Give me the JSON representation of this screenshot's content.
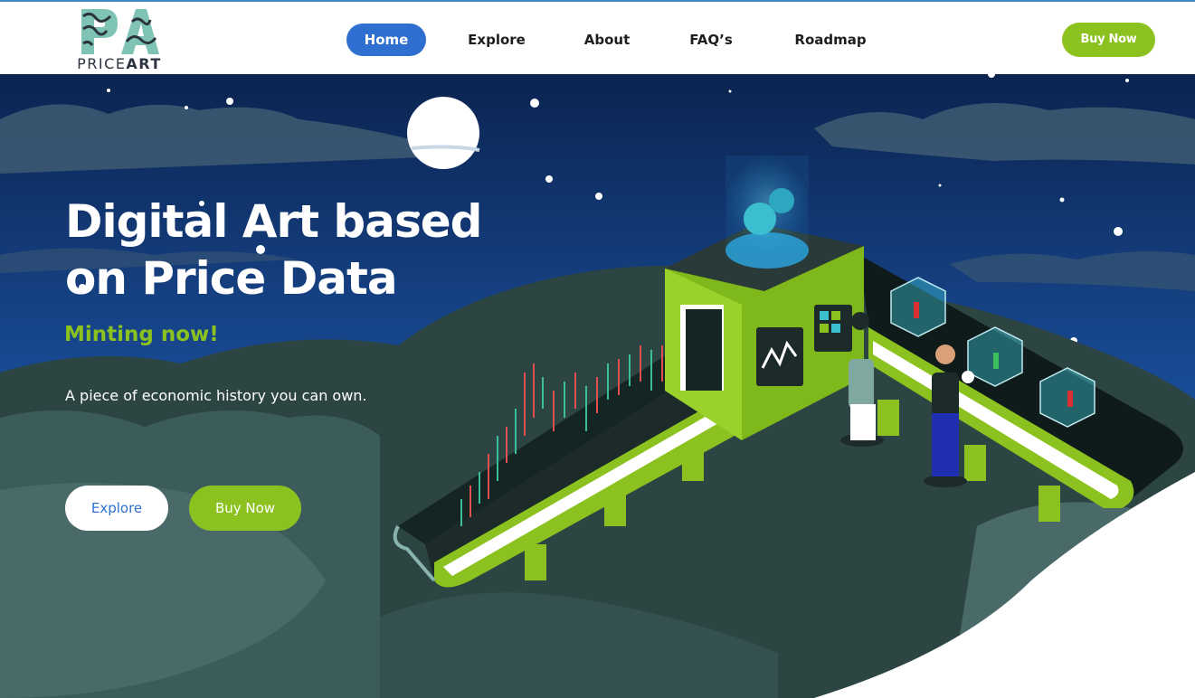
{
  "brand": {
    "logo_letters": "PA",
    "name_part1": "PRICE",
    "name_part2": "ART"
  },
  "nav": {
    "items": [
      {
        "label": "Home",
        "active": true
      },
      {
        "label": "Explore",
        "active": false
      },
      {
        "label": "About",
        "active": false
      },
      {
        "label": "FAQ’s",
        "active": false
      },
      {
        "label": "Roadmap",
        "active": false
      }
    ],
    "buy_label": "Buy Now"
  },
  "hero": {
    "title_line1": "Digital Art based",
    "title_line2": "on Price Data",
    "subtitle": "Minting now!",
    "description": "A piece of economic history you can own.",
    "explore_label": "Explore",
    "buy_label": "Buy Now",
    "illustration": "isometric-price-art-factory"
  },
  "colors": {
    "accent_green": "#8cc21f",
    "accent_blue": "#2f6fd0",
    "sky_top": "#0c2550",
    "sky_bottom": "#1e5fb0",
    "hills": "#2c4a4a",
    "text_dark": "#1e1e1e"
  },
  "icons": {
    "logo": "pa-monogram-icon",
    "moon": "moon-illustration",
    "machine": "factory-machine-illustration"
  }
}
